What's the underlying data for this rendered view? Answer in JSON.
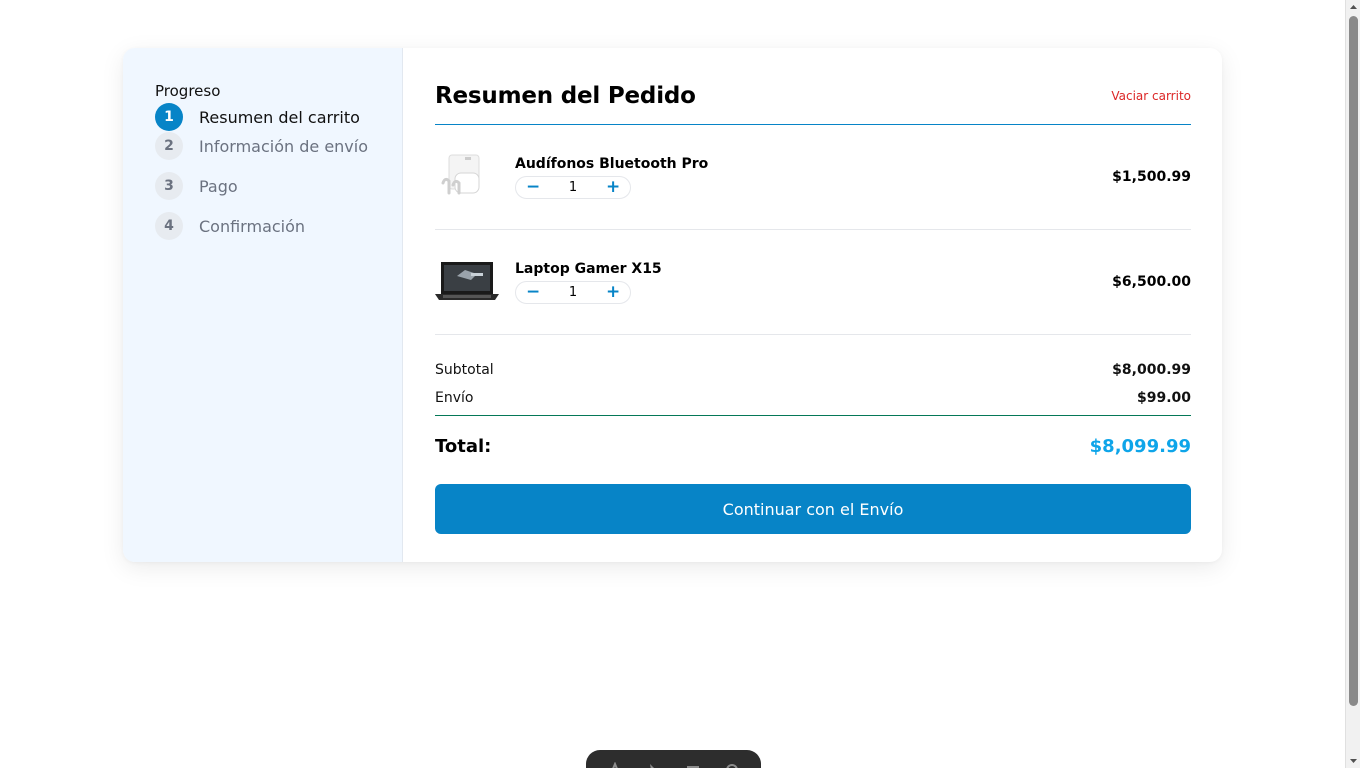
{
  "sidebar": {
    "title": "Progreso",
    "steps": [
      {
        "number": "1",
        "label": "Resumen del carrito",
        "active": true
      },
      {
        "number": "2",
        "label": "Información de envío",
        "active": false
      },
      {
        "number": "3",
        "label": "Pago",
        "active": false
      },
      {
        "number": "4",
        "label": "Confirmación",
        "active": false
      }
    ]
  },
  "main": {
    "title": "Resumen del Pedido",
    "clear_cart": "Vaciar carrito",
    "items": [
      {
        "name": "Audífonos Bluetooth Pro",
        "quantity": "1",
        "price": "$1,500.99",
        "minus": "−",
        "plus": "+",
        "image_icon": "earbuds-image"
      },
      {
        "name": "Laptop Gamer X15",
        "quantity": "1",
        "price": "$6,500.00",
        "minus": "−",
        "plus": "+",
        "image_icon": "laptop-image"
      }
    ],
    "summary": {
      "subtotal_label": "Subtotal",
      "subtotal_value": "$8,000.99",
      "shipping_label": "Envío",
      "shipping_value": "$99.00",
      "total_label": "Total:",
      "total_value": "$8,099.99"
    },
    "cta_label": "Continuar con el Envío"
  },
  "colors": {
    "accent": "#0784c7",
    "danger": "#dc2626",
    "total": "#0ea5e9",
    "sidebar_bg": "#f0f7ff"
  }
}
